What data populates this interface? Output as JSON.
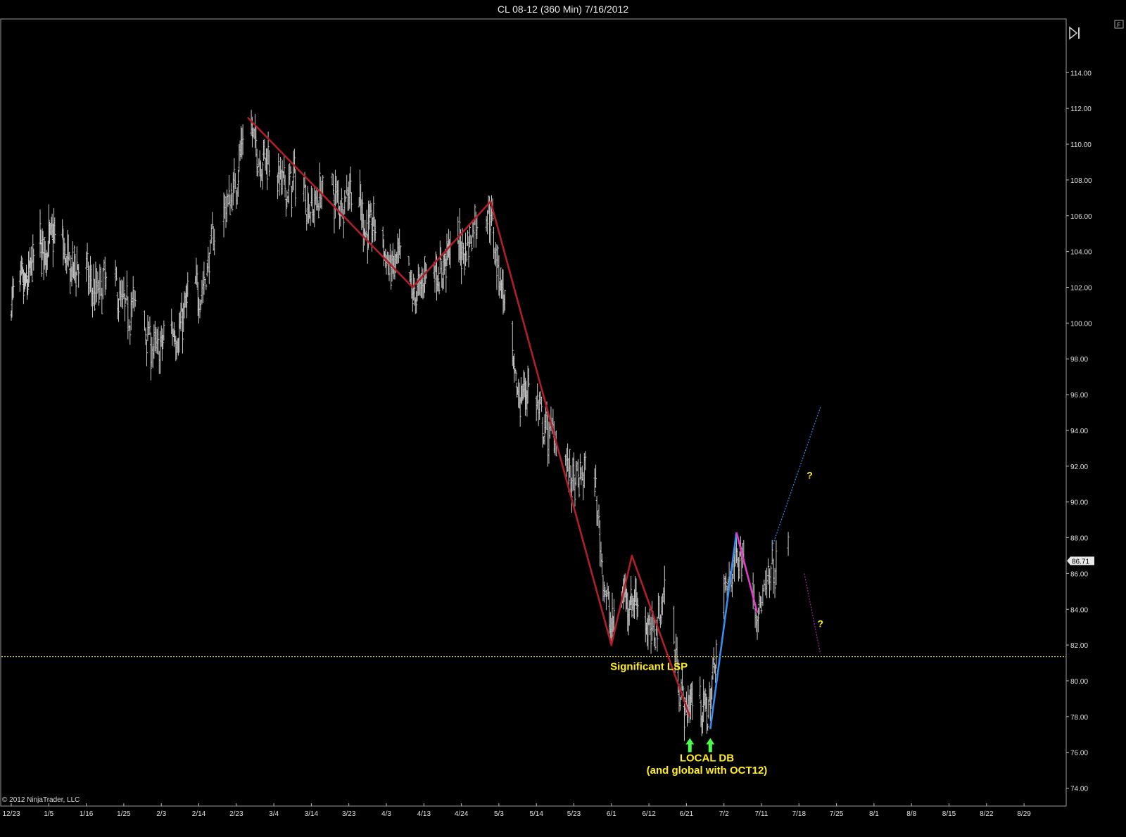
{
  "window": {
    "title": "CL 08-12 (360 Min)  7/16/2012",
    "copyright": "© 2012 NinjaTrader, LLC",
    "panel_tag": "F"
  },
  "colors": {
    "background": "#000000",
    "bars": "#c8c8c8",
    "wave_red": "#b01e28",
    "wave_blue": "#3a8df0",
    "wave_magenta": "#e03cc8",
    "projection_purple": "#9a2fa0",
    "annotation": "#ffee22",
    "arrow": "#4dff4d",
    "level_line": "#ffee22"
  },
  "chart_data": {
    "type": "ohlc",
    "title": "CL 08-12 (360 Min)  7/16/2012",
    "ylim": [
      73,
      117
    ],
    "y_ticks": [
      "74.00",
      "76.00",
      "78.00",
      "80.00",
      "82.00",
      "84.00",
      "86.00",
      "88.00",
      "90.00",
      "92.00",
      "94.00",
      "96.00",
      "98.00",
      "100.00",
      "102.00",
      "104.00",
      "106.00",
      "108.00",
      "110.00",
      "112.00",
      "114.00"
    ],
    "x_ticks": [
      "12/23",
      "1/5",
      "1/16",
      "1/25",
      "2/3",
      "2/14",
      "2/23",
      "3/4",
      "3/14",
      "3/23",
      "4/3",
      "4/13",
      "4/24",
      "5/3",
      "5/14",
      "5/23",
      "6/1",
      "6/12",
      "6/21",
      "7/2",
      "7/11",
      "7/18",
      "7/25",
      "8/1",
      "8/8",
      "8/15",
      "8/22",
      "8/29"
    ],
    "last_price": "86.71",
    "price_path": [
      [
        "12/23",
        101.0
      ],
      [
        "1/5",
        105.0
      ],
      [
        "1/16",
        102.5
      ],
      [
        "1/25",
        101.5
      ],
      [
        "2/3",
        98.5
      ],
      [
        "2/14",
        102.0
      ],
      [
        "2/23",
        108.5
      ],
      [
        "2/26",
        111.0
      ],
      [
        "3/4",
        108.5
      ],
      [
        "3/14",
        107.0
      ],
      [
        "3/23",
        107.5
      ],
      [
        "4/3",
        104.0
      ],
      [
        "4/10",
        102.0
      ],
      [
        "4/24",
        104.5
      ],
      [
        "5/1",
        106.5
      ],
      [
        "5/7",
        97.0
      ],
      [
        "5/14",
        95.5
      ],
      [
        "5/23",
        91.5
      ],
      [
        "5/28",
        91.0
      ],
      [
        "6/1",
        82.5
      ],
      [
        "6/5",
        85.5
      ],
      [
        "6/12",
        83.0
      ],
      [
        "6/16",
        84.5
      ],
      [
        "6/21",
        78.5
      ],
      [
        "6/28",
        79.0
      ],
      [
        "7/2",
        85.0
      ],
      [
        "7/5",
        87.5
      ],
      [
        "7/10",
        84.5
      ],
      [
        "7/16",
        86.7
      ]
    ],
    "wave_lines": [
      {
        "color": "red",
        "points": [
          [
            "2/26",
            111.5
          ],
          [
            "4/10",
            102.0
          ],
          [
            "5/1",
            106.8
          ],
          [
            "6/1",
            82.0
          ],
          [
            "6/7",
            87.0
          ],
          [
            "6/22",
            78.0
          ]
        ]
      },
      {
        "color": "blue",
        "points": [
          [
            "6/28",
            77.3
          ],
          [
            "7/5",
            88.3
          ]
        ]
      },
      {
        "color": "magenta",
        "points": [
          [
            "7/5",
            88.3
          ],
          [
            "7/10",
            83.8
          ]
        ]
      },
      {
        "color": "blue-dotted",
        "points": [
          [
            "7/13",
            87.5
          ],
          [
            "7/22",
            95.3
          ]
        ]
      },
      {
        "color": "purple-dotted",
        "points": [
          [
            "7/19",
            86.0
          ],
          [
            "7/22",
            81.5
          ]
        ]
      }
    ],
    "horizontal_level": 81.35,
    "annotations": [
      {
        "text": "Significant LSP",
        "x": "6/12",
        "y": 80.6
      },
      {
        "text": "LOCAL DB",
        "x": "6/27",
        "y": 75.5
      },
      {
        "text": "(and global with OCT12)",
        "x": "6/27",
        "y": 74.8
      },
      {
        "text": "?",
        "x": "7/20",
        "y": 91.3
      },
      {
        "text": "?",
        "x": "7/22",
        "y": 83.0
      }
    ],
    "arrows": [
      "6/22",
      "6/28"
    ]
  }
}
